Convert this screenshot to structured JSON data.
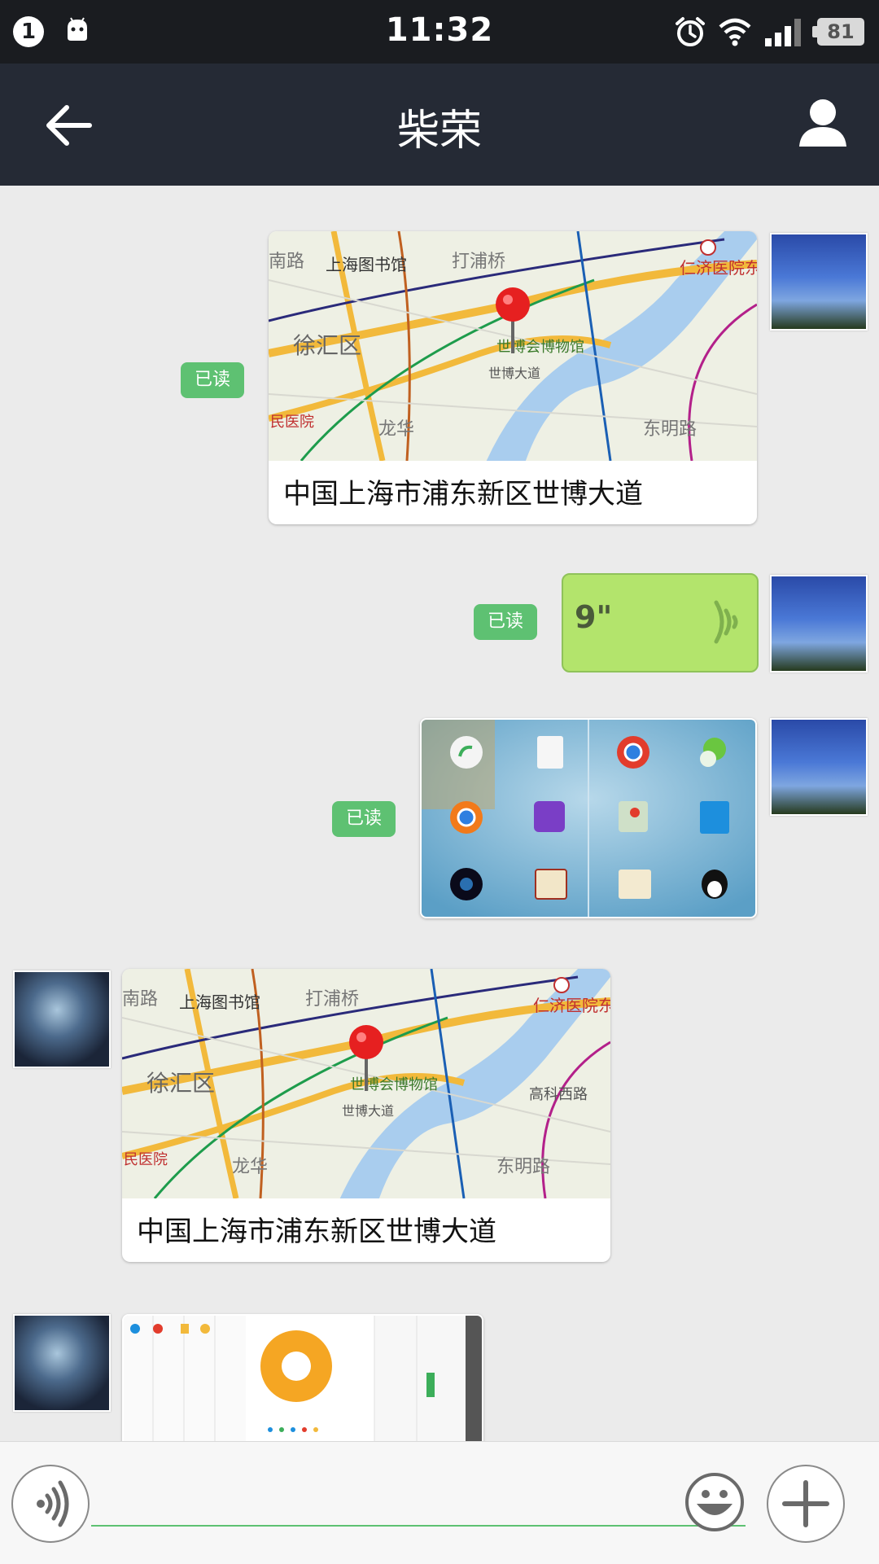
{
  "status_bar": {
    "notification_count": "1",
    "time": "11:32",
    "battery": "81"
  },
  "header": {
    "title": "柴荣"
  },
  "messages": {
    "m1": {
      "address": "中国上海市浦东新区世博大道",
      "read_status": "已读"
    },
    "m2": {
      "duration": "9\"",
      "read_status": "已读"
    },
    "m3": {
      "read_status": "已读"
    },
    "m4": {
      "address": "中国上海市浦东新区世博大道"
    }
  },
  "map_labels": [
    "上海图书馆",
    "打浦桥",
    "徐汇区",
    "世博会博物馆",
    "世博大道",
    "仁济医院东",
    "浦东南路",
    "东明路",
    "龙华",
    "民医院",
    "南路",
    "高科西路"
  ],
  "colors": {
    "status_bar_bg": "#1a1c20",
    "title_bar_bg": "#252a35",
    "chat_bg": "#ebebeb",
    "read_badge": "#5ec172",
    "voice_bubble": "#b3e46c"
  }
}
